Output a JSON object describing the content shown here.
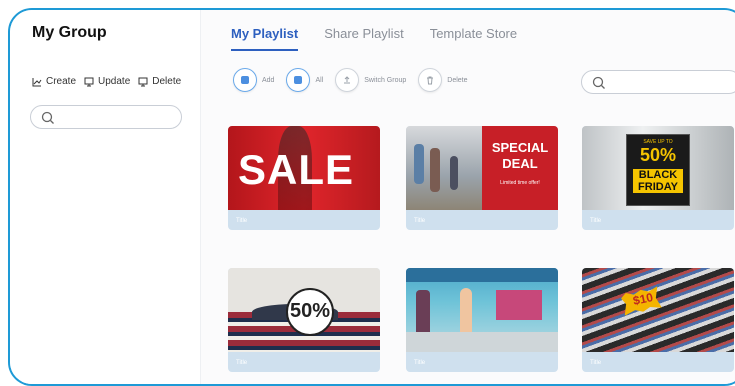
{
  "sidebar": {
    "title": "My Group",
    "actions": [
      {
        "label": "Create",
        "icon": "chart-icon"
      },
      {
        "label": "Update",
        "icon": "monitor-icon"
      },
      {
        "label": "Delete",
        "icon": "monitor-icon"
      }
    ],
    "search": {
      "placeholder": ""
    }
  },
  "tabs": [
    {
      "label": "My Playlist",
      "active": true
    },
    {
      "label": "Share Playlist",
      "active": false
    },
    {
      "label": "Template Store",
      "active": false
    }
  ],
  "toolbar": [
    {
      "label": "Add",
      "icon": "add-icon"
    },
    {
      "label": "All",
      "icon": "all-icon"
    },
    {
      "label": "Switch Group",
      "icon": "switch-group-icon"
    },
    {
      "label": "Delete",
      "icon": "trash-icon"
    }
  ],
  "cards": [
    {
      "title": "Title",
      "image": "sale-banner",
      "text": "SALE"
    },
    {
      "title": "Title",
      "image": "special-deal-banner",
      "text": "SPECIAL DEAL",
      "subtext": "Limited time offer!"
    },
    {
      "title": "Title",
      "image": "black-friday-banner",
      "text": "SAVE UP TO",
      "percent": "50%",
      "text2": "BLACK FRIDAY"
    },
    {
      "title": "Title",
      "image": "clothing-rack-50",
      "text": "50%"
    },
    {
      "title": "Title",
      "image": "shopping-mall-woman"
    },
    {
      "title": "Title",
      "image": "sunglasses-sale",
      "text": "$10"
    }
  ],
  "colors": {
    "accent": "#2d5fbf",
    "frame": "#1e9ad6",
    "card_footer": "#cfe0ee"
  }
}
